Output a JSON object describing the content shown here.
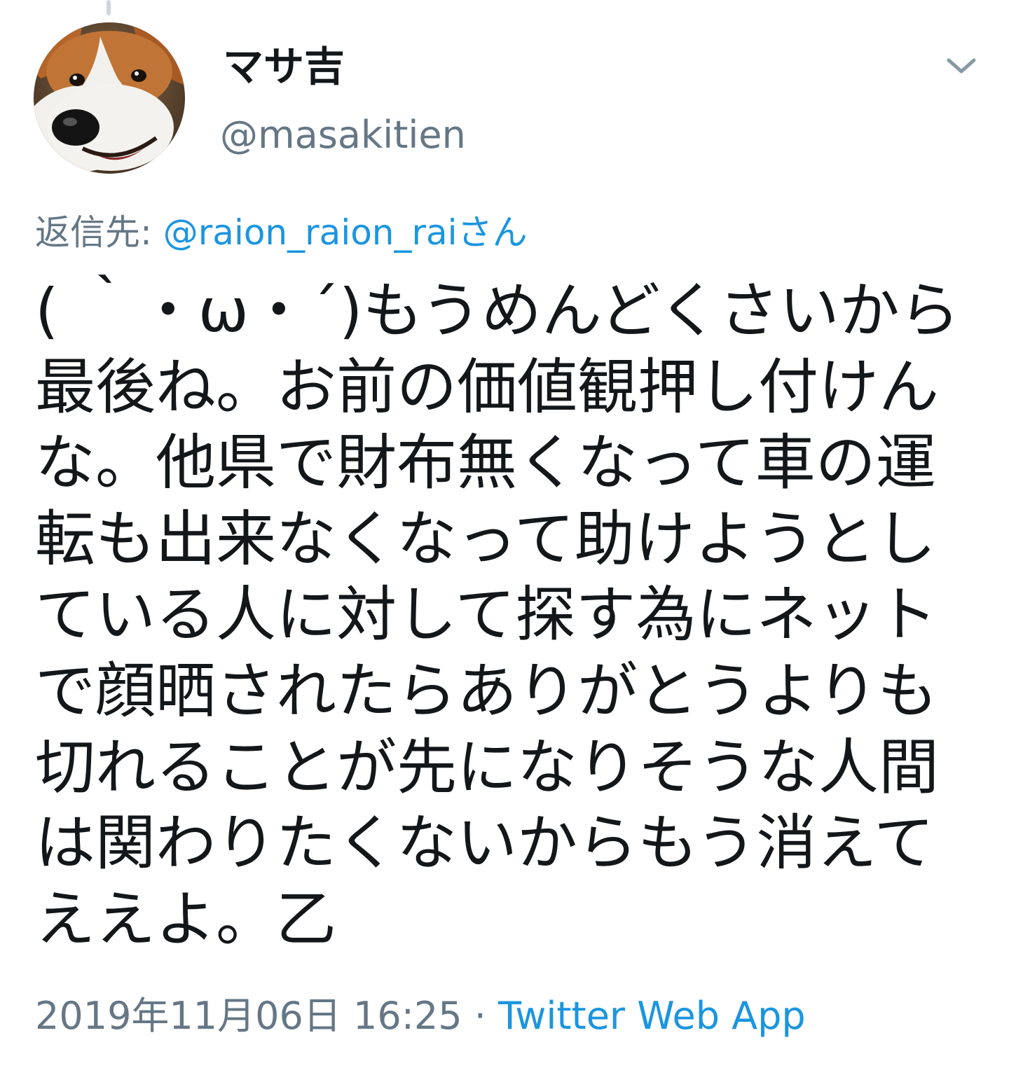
{
  "tweet": {
    "display_name": "マサ吉",
    "handle": "@masakitien",
    "reply_prefix": "返信先: ",
    "reply_to": "@raion_raion_raiさん",
    "lines": [
      "( ｀・ω・´)もうめんどくさいから",
      "最後ね。お前の価値観押し付けん",
      "な。他県で財布無くなって車の運",
      "転も出来なくなって助けようとし",
      "ている人に対して探す為にネット",
      "で顔晒されたらありがとうよりも",
      "切れることが先になりそうな人間",
      "は関わりたくないからもう消えて",
      "ええよ。乙"
    ],
    "timestamp": "2019年11月06日 16:25",
    "separator": " · ",
    "source": "Twitter Web App",
    "caret_icon": "chevron-down-icon",
    "avatar_icon": "dog-avatar",
    "colors": {
      "link": "#1b95e0",
      "secondary": "#657786",
      "text": "#14171a"
    }
  }
}
